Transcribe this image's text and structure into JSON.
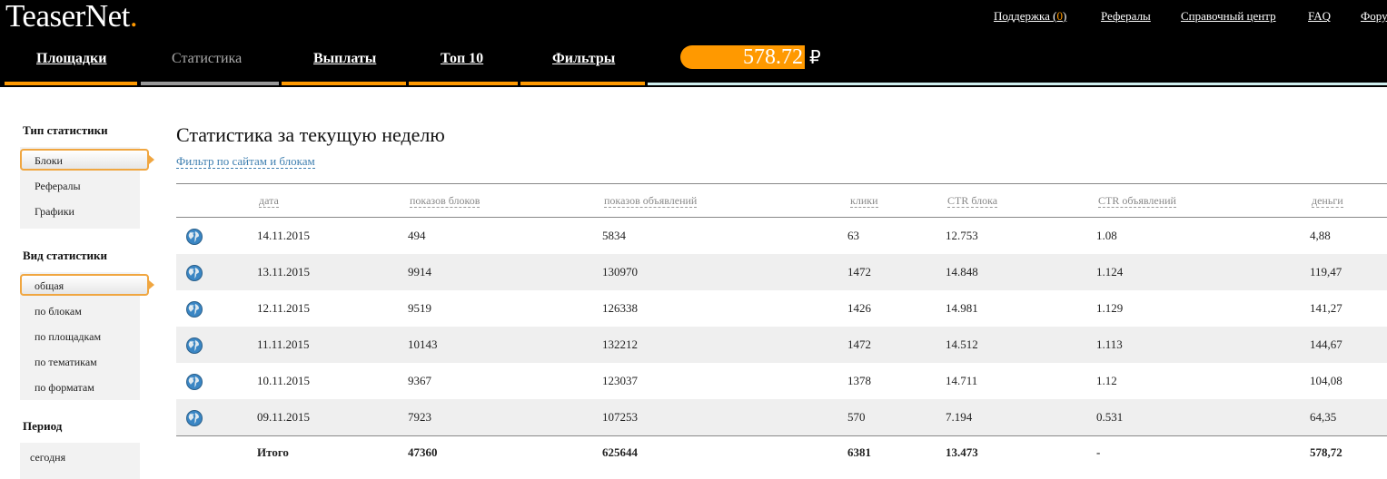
{
  "logo": {
    "text": "TeaserNet",
    "dot": "."
  },
  "top_links": [
    {
      "label": "Поддержка (",
      "count": "0",
      "tail": ")"
    },
    {
      "label": "Рефералы"
    },
    {
      "label": "Справочный центр"
    },
    {
      "label": "FAQ"
    },
    {
      "label": "Форум"
    }
  ],
  "nav": [
    {
      "label": "Площадки"
    },
    {
      "label": "Статистика",
      "active": true
    },
    {
      "label": "Выплаты"
    },
    {
      "label": "Топ 10"
    },
    {
      "label": "Фильтры"
    }
  ],
  "balance": {
    "value": "578.72",
    "currency": "₽"
  },
  "sidebar": {
    "type_title": "Тип статистики",
    "type_items": [
      "Блоки",
      "Рефералы",
      "Графики"
    ],
    "type_active": 0,
    "view_title": "Вид статистики",
    "view_items": [
      "общая",
      "по блокам",
      "по площадкам",
      "по тематикам",
      "по форматам"
    ],
    "view_active": 0,
    "period_title": "Период",
    "period_items": [
      "сегодня"
    ]
  },
  "main": {
    "title": "Статистика за текущую неделю",
    "filter_link": "Фильтр по сайтам и блокам"
  },
  "table": {
    "headers": [
      "дата",
      "показов блоков",
      "показов объявлений",
      "клики",
      "CTR блока",
      "CTR объявлений",
      "деньги"
    ],
    "rows": [
      [
        "14.11.2015",
        "494",
        "5834",
        "63",
        "12.753",
        "1.08",
        "4,88"
      ],
      [
        "13.11.2015",
        "9914",
        "130970",
        "1472",
        "14.848",
        "1.124",
        "119,47"
      ],
      [
        "12.11.2015",
        "9519",
        "126338",
        "1426",
        "14.981",
        "1.129",
        "141,27"
      ],
      [
        "11.11.2015",
        "10143",
        "132212",
        "1472",
        "14.512",
        "1.113",
        "144,67"
      ],
      [
        "10.11.2015",
        "9367",
        "123037",
        "1378",
        "14.711",
        "1.12",
        "104,08"
      ],
      [
        "09.11.2015",
        "7923",
        "107253",
        "570",
        "7.194",
        "0.531",
        "64,35"
      ]
    ],
    "total": [
      "Итого",
      "47360",
      "625644",
      "6381",
      "13.473",
      "-",
      "578,72"
    ]
  },
  "colors": {
    "accent": "#ff9900",
    "header_bg": "#000000",
    "link": "#3f7fb0",
    "row_alt": "#efefef"
  }
}
